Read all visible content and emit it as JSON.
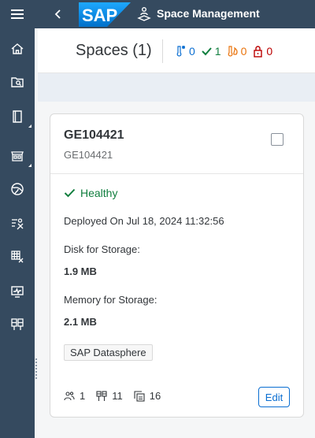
{
  "shell": {
    "title": "Space Management",
    "logo_text": "SAP",
    "colors": {
      "shell_bg": "#354a5f",
      "accent": "#0a6ed1"
    }
  },
  "rail": {
    "items": [
      {
        "name": "menu-icon"
      },
      {
        "name": "home-icon"
      },
      {
        "name": "data-search-icon"
      },
      {
        "name": "book-icon"
      },
      {
        "name": "marketplace-icon"
      },
      {
        "name": "globe-icon"
      },
      {
        "name": "tools-icon"
      },
      {
        "name": "grid-settings-icon"
      },
      {
        "name": "monitor-icon"
      },
      {
        "name": "spaces-icon"
      }
    ]
  },
  "header": {
    "title": "Spaces (1)",
    "counters": [
      {
        "icon": "cold-thermometer-icon",
        "value": "0",
        "color": "#0a6ed1"
      },
      {
        "icon": "checkmark-icon",
        "value": "1",
        "color": "#107e3e"
      },
      {
        "icon": "hot-thermometer-icon",
        "value": "0",
        "color": "#e9730c"
      },
      {
        "icon": "lock-icon",
        "value": "0",
        "color": "#bb0000"
      }
    ]
  },
  "card": {
    "title": "GE104421",
    "subtitle": "GE104421",
    "status": "Healthy",
    "deployed": "Deployed On Jul 18, 2024 11:32:56",
    "disk_label": "Disk for Storage:",
    "disk_value": "1.9 MB",
    "memory_label": "Memory for Storage:",
    "memory_value": "2.1 MB",
    "tag": "SAP Datasphere",
    "metrics": {
      "users": "1",
      "connections": "11",
      "objects": "16"
    },
    "edit_label": "Edit"
  }
}
